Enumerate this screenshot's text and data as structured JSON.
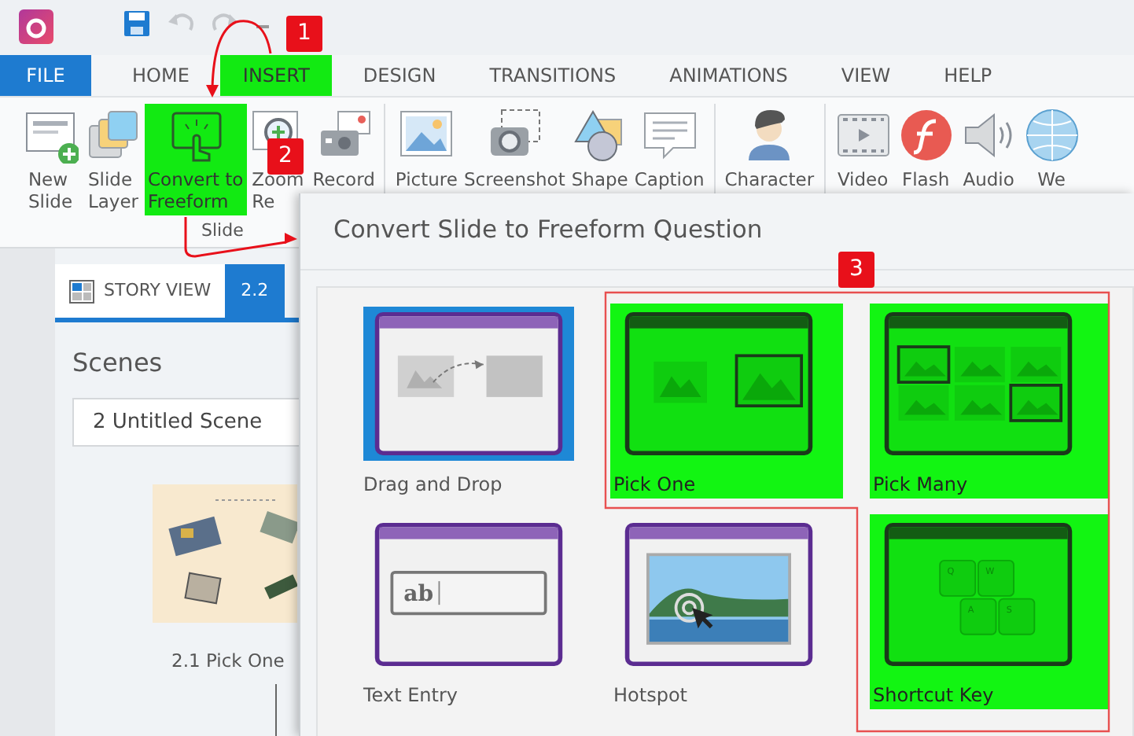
{
  "ribbon_tabs": [
    {
      "label": "FILE",
      "kind": "file",
      "selected": false
    },
    {
      "label": "HOME",
      "kind": "tab",
      "selected": false
    },
    {
      "label": "INSERT",
      "kind": "tab",
      "selected": true
    },
    {
      "label": "DESIGN",
      "kind": "tab",
      "selected": false
    },
    {
      "label": "TRANSITIONS",
      "kind": "tab",
      "selected": false
    },
    {
      "label": "ANIMATIONS",
      "kind": "tab",
      "selected": false
    },
    {
      "label": "VIEW",
      "kind": "tab",
      "selected": false
    },
    {
      "label": "HELP",
      "kind": "tab",
      "selected": false
    }
  ],
  "ribbon": {
    "buttons": [
      {
        "label": "New\nSlide",
        "kind": "new-slide",
        "highlighted": false
      },
      {
        "label": "Slide\nLayer",
        "kind": "slide-layer",
        "highlighted": false
      },
      {
        "label": "Convert to\nFreeform",
        "kind": "convert",
        "highlighted": true
      },
      {
        "label": "Zoom\nRe",
        "kind": "zoom",
        "highlighted": false
      },
      {
        "label": "Record",
        "kind": "record",
        "highlighted": false,
        "separator_after": true
      },
      {
        "label": "Picture",
        "kind": "picture",
        "highlighted": false
      },
      {
        "label": "Screenshot",
        "kind": "screenshot",
        "highlighted": false
      },
      {
        "label": "Shape",
        "kind": "shape",
        "highlighted": false
      },
      {
        "label": "Caption",
        "kind": "caption",
        "highlighted": false,
        "separator_after": true
      },
      {
        "label": "Character",
        "kind": "character",
        "highlighted": false,
        "separator_after": true
      },
      {
        "label": "Video",
        "kind": "video",
        "highlighted": false
      },
      {
        "label": "Flash",
        "kind": "flash",
        "highlighted": false
      },
      {
        "label": "Audio",
        "kind": "audio",
        "highlighted": false
      },
      {
        "label": "We",
        "kind": "web",
        "highlighted": false
      }
    ],
    "group_label": "Slide"
  },
  "story_panel": {
    "tabs": [
      {
        "label": "STORY VIEW",
        "kind": "story",
        "selected": false
      },
      {
        "label": "2.2",
        "kind": "slide",
        "selected": true
      }
    ],
    "heading": "Scenes",
    "scene_select": "2 Untitled Scene",
    "slides": [
      {
        "label": "2.1 Pick One",
        "kind": "picture"
      }
    ]
  },
  "dialog": {
    "title": "Convert Slide to Freeform Question",
    "options": [
      {
        "label": "Drag and Drop",
        "kind": "drag-drop",
        "selected": true,
        "highlighted": false
      },
      {
        "label": "Pick One",
        "kind": "pick-one",
        "selected": false,
        "highlighted": true
      },
      {
        "label": "Pick Many",
        "kind": "pick-many",
        "selected": false,
        "highlighted": true
      },
      {
        "label": "Text Entry",
        "kind": "text-entry",
        "selected": false,
        "highlighted": false,
        "sample": "ab"
      },
      {
        "label": "Hotspot",
        "kind": "hotspot",
        "selected": false,
        "highlighted": false
      },
      {
        "label": "Shortcut Key",
        "kind": "shortcut-key",
        "selected": false,
        "highlighted": true,
        "keys": [
          "Q",
          "W",
          "A",
          "S"
        ]
      }
    ]
  },
  "annotations": [
    {
      "number": "1",
      "kind": "tab-arrow"
    },
    {
      "number": "2",
      "kind": "button-arrow"
    },
    {
      "number": "3",
      "kind": "outline"
    }
  ]
}
